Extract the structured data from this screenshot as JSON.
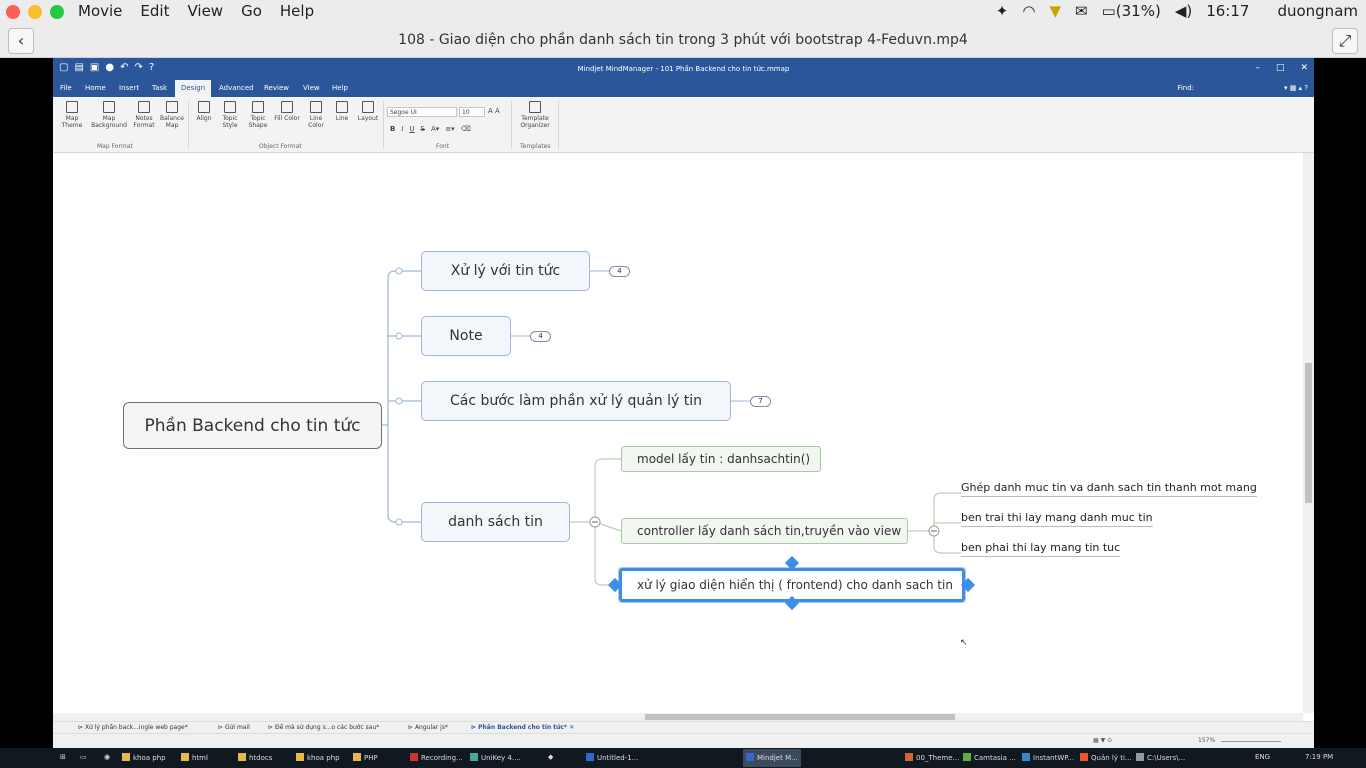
{
  "macos": {
    "menus": [
      "Movie",
      "Edit",
      "View",
      "Go",
      "Help"
    ],
    "battery": "(31%)",
    "time": "16:17",
    "user": "duongnam"
  },
  "player": {
    "title": "108 - Giao diện cho phần danh sách tin trong 3 phút với bootstrap 4-Feduvn.mp4"
  },
  "app": {
    "window_title": "Mindjet MindManager - 101 Phần Backend cho tin tức.mmap",
    "tabs": [
      "File",
      "Home",
      "Insert",
      "Task",
      "Design",
      "Advanced",
      "Review",
      "View",
      "Help"
    ],
    "active_tab": "Design",
    "find_label": "Find:",
    "ribbon": {
      "map_format": {
        "buttons": [
          "Map Theme",
          "Map Background",
          "Notes Format",
          "Balance Map"
        ],
        "label": "Map Format"
      },
      "object_format": {
        "buttons": [
          "Align",
          "Topic Style",
          "Topic Shape",
          "Fill Color",
          "Line Color",
          "Line",
          "Layout"
        ],
        "label": "Object Format"
      },
      "font": {
        "family": "Segoe UI",
        "size": "10",
        "style_buttons": [
          "B",
          "I",
          "U",
          "S"
        ],
        "label": "Font"
      },
      "templates": {
        "button": "Template Organizer",
        "label": "Templates"
      }
    }
  },
  "mindmap": {
    "central": "Phần Backend cho tin tức",
    "main_topics": [
      {
        "label": "Xử lý với tin tức",
        "badge": "4"
      },
      {
        "label": "Note",
        "badge": "4"
      },
      {
        "label": "Các bước làm phần xử lý quản lý tin",
        "badge": "7"
      },
      {
        "label": "danh sách tin"
      }
    ],
    "subtopics": [
      "model lấy tin : danhsachtin()",
      "controller lấy danh sách tin,truyền vào view",
      "xử lý giao diện hiển thị ( frontend) cho danh sach tin"
    ],
    "leaves": [
      "Ghép danh muc tin va danh sach tin thanh mot mang",
      "ben trai thi lay mang danh muc tin",
      "ben phai thi lay mang tin tuc"
    ]
  },
  "doc_tabs": [
    "Xử lý phần back...ingle web page*",
    "Gửi mail",
    "Để mà sử dụng s...o các bước sau*",
    "Angular js*",
    "Phần Backend cho tin tức*"
  ],
  "status": {
    "zoom": "157%"
  },
  "taskbar": {
    "items": [
      "khoa php",
      "html",
      "htdocs",
      "khoa php",
      "PHP",
      "Recording...",
      "UniKey 4....",
      "Untitled-1...",
      "Mindjet M...",
      "00_Theme...",
      "Camtasia ...",
      "InstantWP...",
      "Quản lý ti...",
      "C:\\Users\\..."
    ],
    "lang": "ENG",
    "time": "7:19 PM"
  }
}
